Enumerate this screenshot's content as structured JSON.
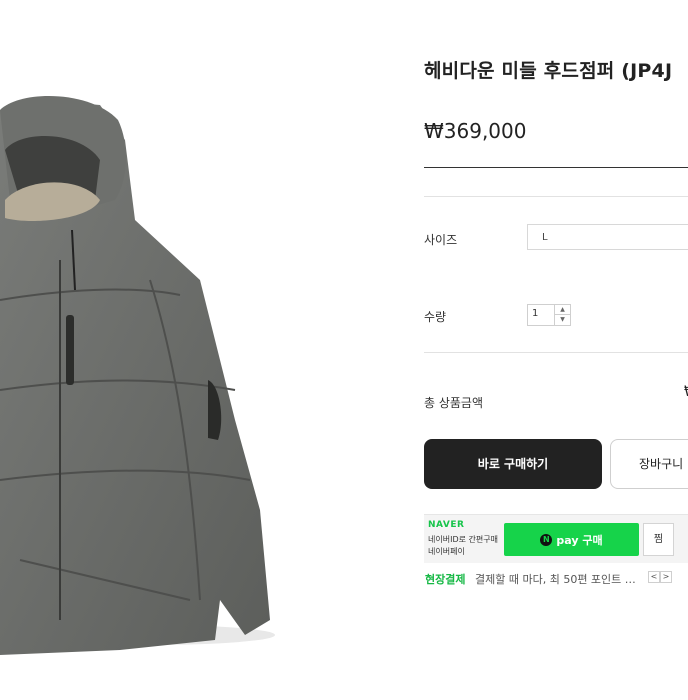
{
  "product": {
    "title": "헤비다운 미들 후드점퍼 (JP4J",
    "price": "₩369,000",
    "image_alt": "gray hooded puffer jacket"
  },
  "options": {
    "size_label": "사이즈",
    "size_value": "L",
    "quantity_label": "수량",
    "quantity_value": "1"
  },
  "total": {
    "label": "총 상품금액",
    "currency": "₩"
  },
  "actions": {
    "buy_label": "바로 구매하기",
    "cart_label": "장바구니"
  },
  "naver": {
    "logo": "NAVER",
    "line1": "네이버ID로 간편구매",
    "line2": "네이버페이",
    "npay_badge": "N",
    "npay_label": "pay 구매",
    "wish_label": "찜",
    "promo_label": "현장결제",
    "promo_text": "결제할 때 마다, 최 50편 포인트 …",
    "prev_icon": "<",
    "next_icon": ">"
  },
  "colors": {
    "jacket": "#6b6d6a",
    "buy_button": "#222222",
    "npay_green": "#16d34a"
  }
}
